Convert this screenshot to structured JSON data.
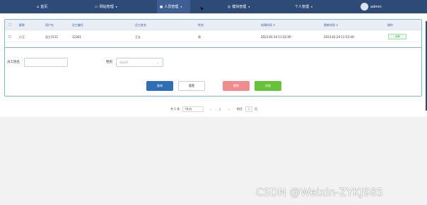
{
  "nav": {
    "items": [
      {
        "label": "首页",
        "icon": "home-icon"
      },
      {
        "label": "网站管理",
        "icon": "website-icon"
      },
      {
        "label": "人员管理",
        "icon": "user-icon"
      },
      {
        "label": "模块管理",
        "icon": "module-icon"
      },
      {
        "label": "个人管理",
        "icon": ""
      }
    ],
    "active_index": 2,
    "user": "admin",
    "caret": "▾"
  },
  "table": {
    "headers": [
      "昵称",
      "用户名",
      "员工编号",
      "员工姓名",
      "性别",
      "创建时间 ↕",
      "更新时间 ↕",
      "操作"
    ],
    "rows": [
      [
        "小王",
        "员工1111",
        "12361",
        "王五",
        "男",
        "2023-01-24 11:52:49",
        "2023-01-24 11:52:49",
        "详情"
      ]
    ]
  },
  "form": {
    "name_label": "员工姓名",
    "name_value": "",
    "gender_label": "性别",
    "gender_placeholder": "请选择",
    "query_label": "查询",
    "reset_label": "重置",
    "delete_label": "删除",
    "add_label": "添加"
  },
  "pager": {
    "total": "共 1 条",
    "page_size": "7条/页",
    "prev": "<",
    "current": "1",
    "next": ">",
    "goto_label": "前往",
    "goto_value": "1",
    "page_unit": "页"
  },
  "watermark": "CSDN @Weixin-ZYKJ985",
  "colors": {
    "nav_bg": "#2e4b78",
    "query": "#2f6db7",
    "delete": "#f08c8c",
    "add": "#67c23a",
    "border": "#7fb7d6"
  }
}
